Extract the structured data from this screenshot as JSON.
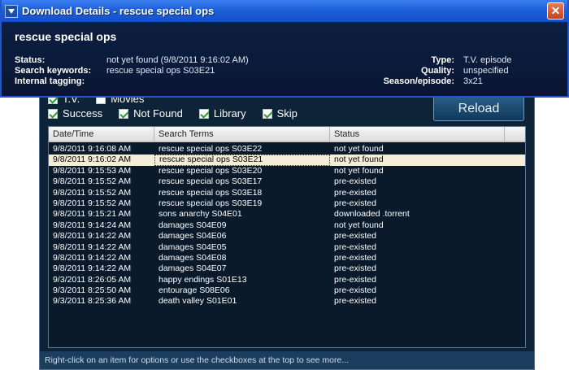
{
  "details": {
    "window_title": "Download Details - rescue special ops",
    "show_title": "rescue special ops",
    "status_label": "Status:",
    "status_value": "not yet found (9/8/2011 9:16:02 AM)",
    "keywords_label": "Search keywords:",
    "keywords_value": "rescue special ops S03E21",
    "tagging_label": "Internal tagging:",
    "type_label": "Type:",
    "type_value": "T.V. episode",
    "quality_label": "Quality:",
    "quality_value": "unspecified",
    "season_label": "Season/episode:",
    "season_value": "3x21"
  },
  "filters": {
    "row1": [
      {
        "label": "T.V.",
        "checked": true
      },
      {
        "label": "Movies",
        "checked": false
      }
    ],
    "row2": [
      {
        "label": "Success",
        "checked": true
      },
      {
        "label": "Not Found",
        "checked": true
      },
      {
        "label": "Library",
        "checked": true
      },
      {
        "label": "Skip",
        "checked": true
      }
    ],
    "reload_label": "Reload"
  },
  "table": {
    "headers": [
      "Date/Time",
      "Search Terms",
      "Status"
    ],
    "selected_index": 1,
    "rows": [
      [
        "9/8/2011 9:16:08 AM",
        "rescue special ops S03E22",
        "not yet found"
      ],
      [
        "9/8/2011 9:16:02 AM",
        "rescue special ops S03E21",
        "not yet found"
      ],
      [
        "9/8/2011 9:15:53 AM",
        "rescue special ops S03E20",
        "not yet found"
      ],
      [
        "9/8/2011 9:15:52 AM",
        "rescue special ops S03E17",
        "pre-existed"
      ],
      [
        "9/8/2011 9:15:52 AM",
        "rescue special ops S03E18",
        "pre-existed"
      ],
      [
        "9/8/2011 9:15:52 AM",
        "rescue special ops S03E19",
        "pre-existed"
      ],
      [
        "9/8/2011 9:15:21 AM",
        "sons anarchy S04E01",
        "downloaded .torrent"
      ],
      [
        "9/8/2011 9:14:24 AM",
        "damages S04E09",
        "not yet found"
      ],
      [
        "9/8/2011 9:14:22 AM",
        "damages S04E06",
        "pre-existed"
      ],
      [
        "9/8/2011 9:14:22 AM",
        "damages S04E05",
        "pre-existed"
      ],
      [
        "9/8/2011 9:14:22 AM",
        "damages S04E08",
        "pre-existed"
      ],
      [
        "9/8/2011 9:14:22 AM",
        "damages S04E07",
        "pre-existed"
      ],
      [
        "9/3/2011 8:26:05 AM",
        "happy endings S01E13",
        "pre-existed"
      ],
      [
        "9/3/2011 8:25:50 AM",
        "entourage S08E06",
        "pre-existed"
      ],
      [
        "9/3/2011 8:25:36 AM",
        "death valley S01E01",
        "pre-existed"
      ]
    ]
  },
  "status_bar": "Right-click on an item for options or use the checkboxes at the top to see more...",
  "colors": {
    "titlebar": "#1e5fd8",
    "panel_bg": "#0f2338",
    "selected_row": "#f5edd8",
    "check": "#2a9a2a"
  }
}
